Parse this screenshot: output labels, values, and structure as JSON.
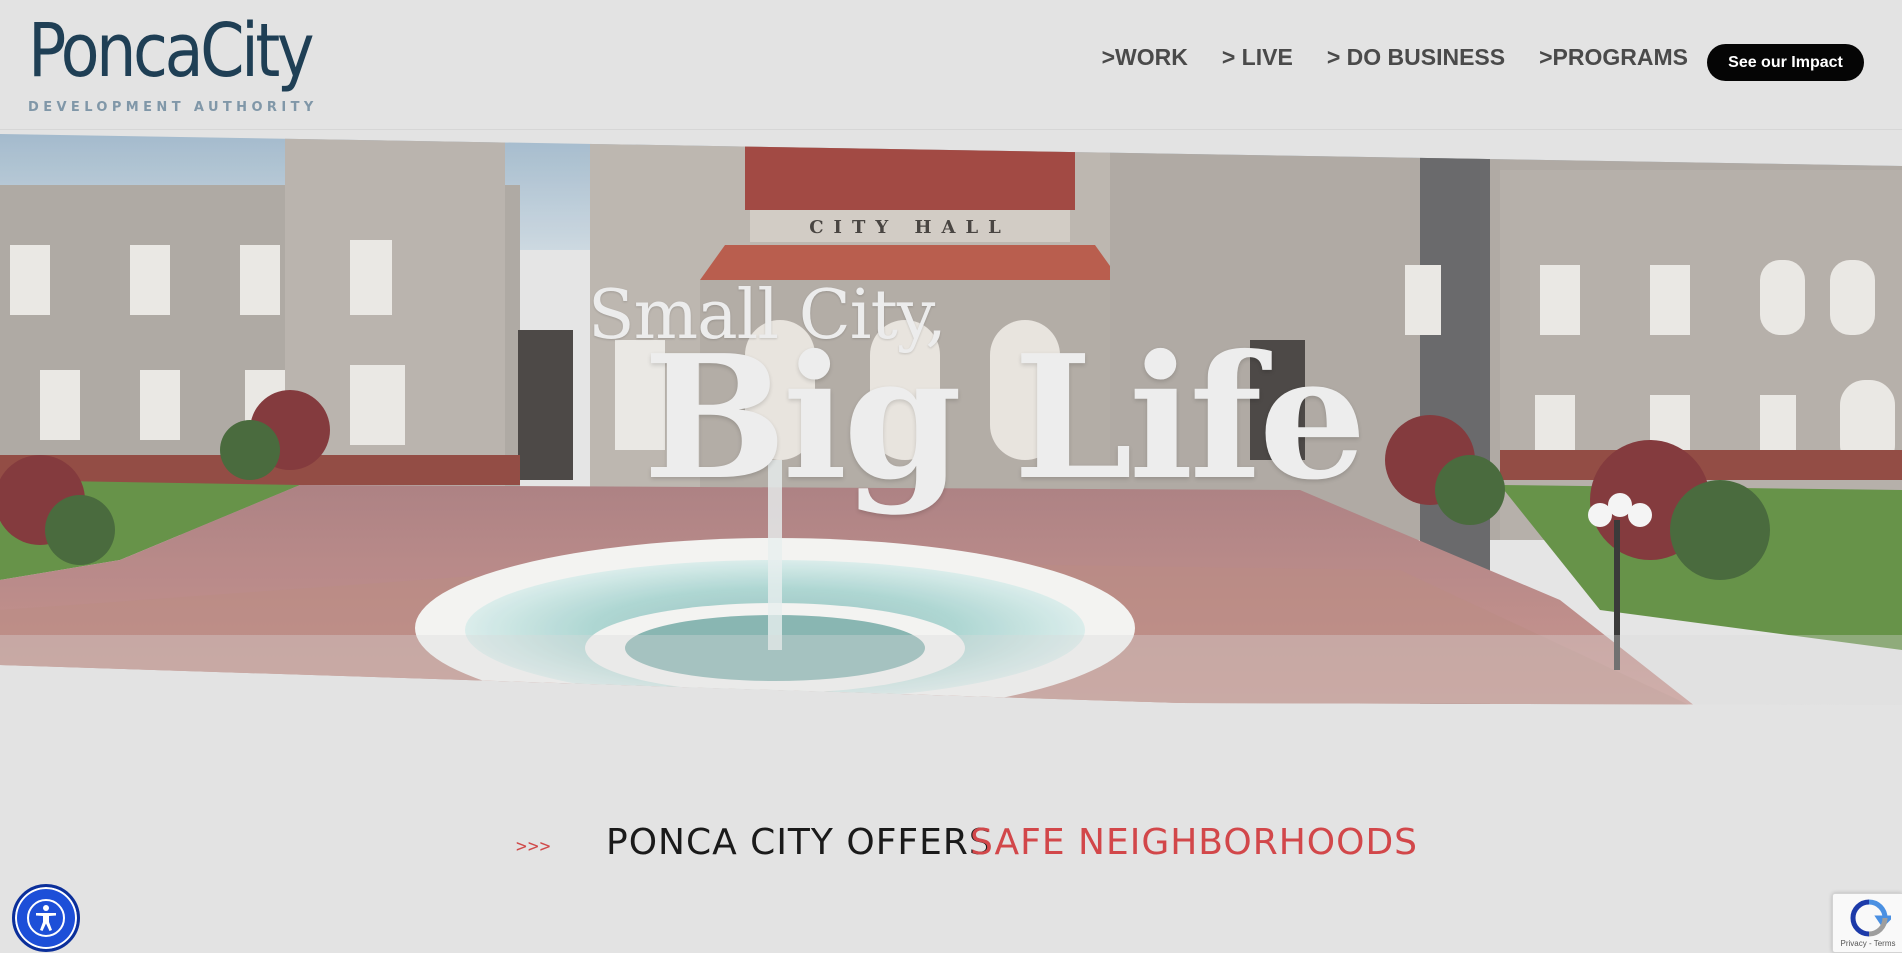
{
  "header": {
    "logo_main": "PoncaCity",
    "logo_sub": "DEVELOPMENT AUTHORITY",
    "nav": [
      {
        "label": ">WORK"
      },
      {
        "label": "> LIVE"
      },
      {
        "label": "> DO BUSINESS"
      },
      {
        "label": ">PROGRAMS"
      }
    ],
    "cta_label": "See our Impact"
  },
  "hero": {
    "title_line1": "Small City,",
    "title_line2": "Big Life",
    "building_sign": "CITY HALL"
  },
  "offers": {
    "arrows": ">>>",
    "prefix": "PONCA CITY OFFERS",
    "highlight": "SAFE NEIGHBORHOODS"
  },
  "recaptcha": {
    "text": "Privacy - Terms"
  },
  "colors": {
    "brand_navy": "#1f3f55",
    "accent_red": "#d2474a",
    "cta_bg": "#050505",
    "a11y_blue": "#1d4fd8"
  },
  "icons": {
    "accessibility": "accessibility-icon",
    "recaptcha": "recaptcha-icon"
  }
}
